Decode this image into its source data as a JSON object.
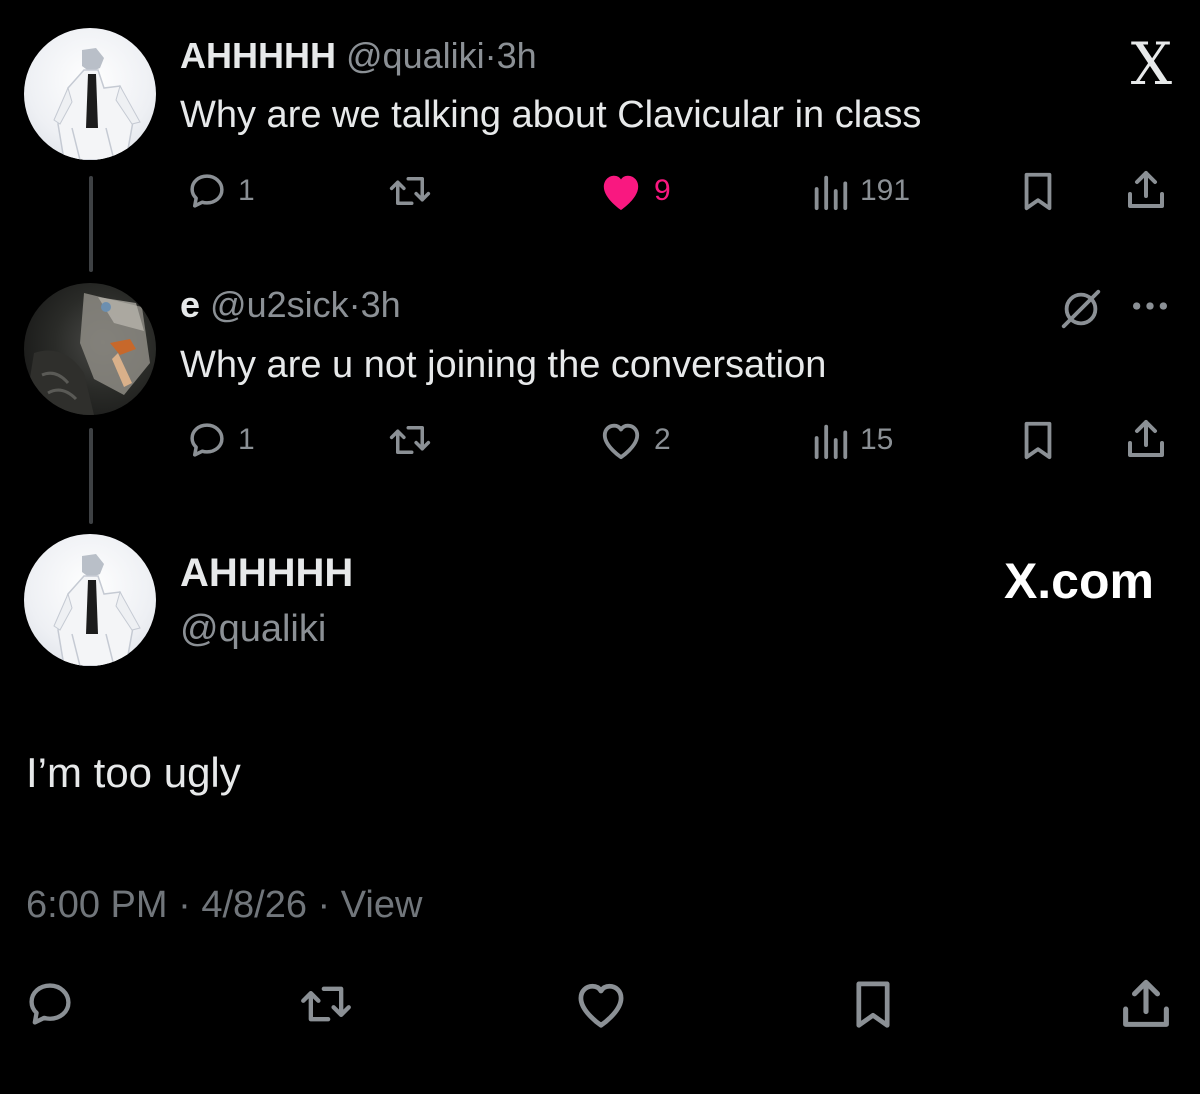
{
  "tweet1": {
    "name": "AHHHHH",
    "handle": "@qualiki",
    "time": "3h",
    "text": "Why are we talking about Clavicular in class",
    "replies": "1",
    "likes": "9",
    "views": "191",
    "liked": true,
    "logo": "X"
  },
  "tweet2": {
    "name": "e",
    "handle": "@u2sick",
    "time": "3h",
    "text": "Why are u not joining the conversation",
    "replies": "1",
    "likes": "2",
    "views": "15"
  },
  "main": {
    "name": "AHHHHH",
    "handle": "@qualiki",
    "brand": "X.com",
    "text": "I’m too ugly",
    "timestamp": "6:00 PM",
    "date": "4/8/26",
    "view_label": "View",
    "separator": "·"
  },
  "colors": {
    "background": "#000000",
    "text": "#e7e9ea",
    "muted": "#8b9095",
    "like": "#f91880",
    "thread_line": "#3e4144"
  },
  "icons": [
    "reply-icon",
    "retweet-icon",
    "like-icon",
    "views-icon",
    "bookmark-icon",
    "share-icon",
    "grok-icon",
    "more-icon",
    "x-logo-icon"
  ]
}
